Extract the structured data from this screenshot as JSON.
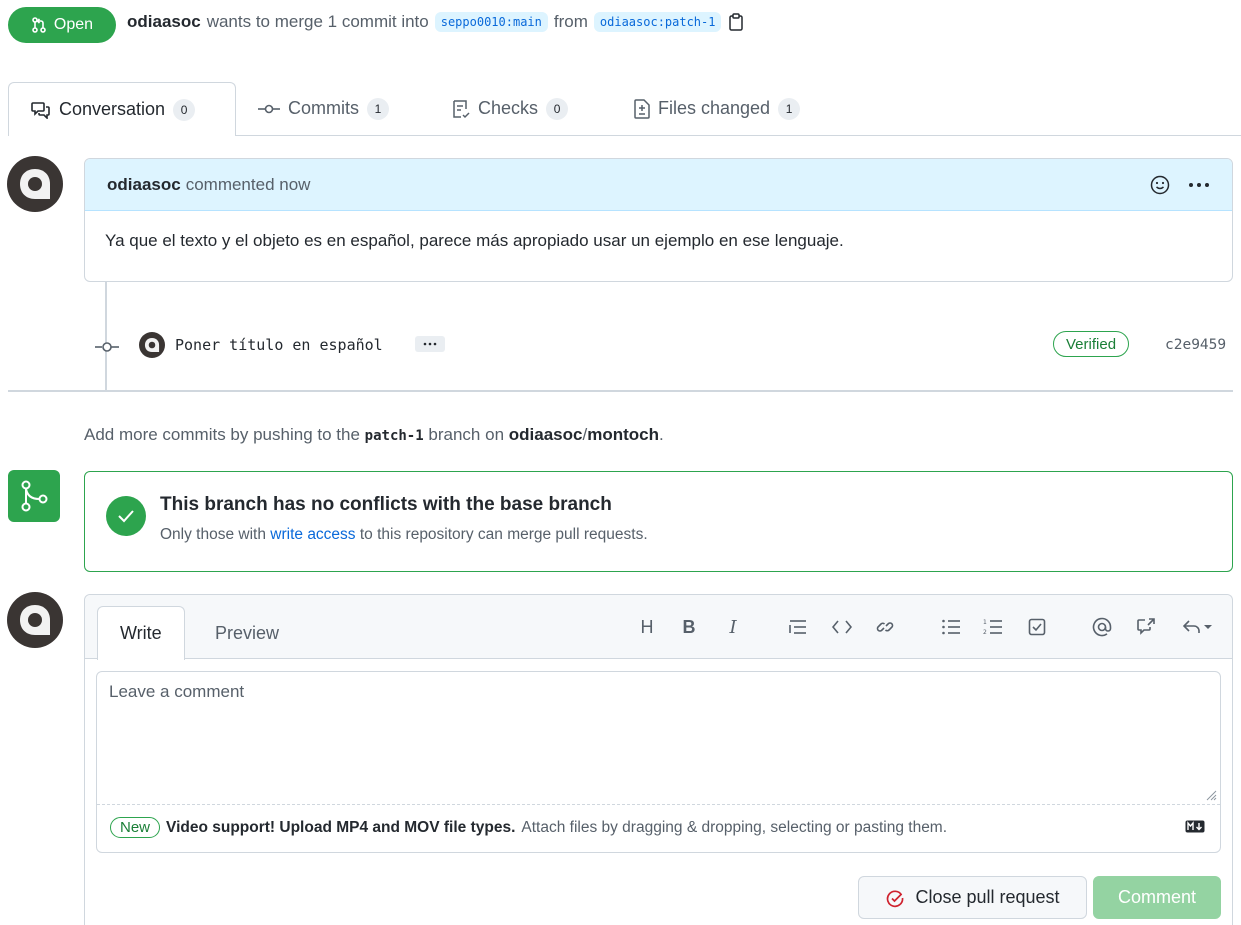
{
  "header": {
    "state": "Open",
    "author": "odiaasoc",
    "summary": "wants to merge 1 commit into",
    "base_branch": "seppo0010:main",
    "from_word": "from",
    "head_branch": "odiaasoc:patch-1"
  },
  "tabs": [
    {
      "label": "Conversation",
      "count": "0"
    },
    {
      "label": "Commits",
      "count": "1"
    },
    {
      "label": "Checks",
      "count": "0"
    },
    {
      "label": "Files changed",
      "count": "1"
    }
  ],
  "comment": {
    "author": "odiaasoc",
    "action": "commented now",
    "body": "Ya que el texto y el objeto es en español, parece más apropiado usar un ejemplo en ese lenguaje."
  },
  "commit": {
    "message": "Poner título en español",
    "verified": "Verified",
    "sha": "c2e9459"
  },
  "push_hint": {
    "prefix": "Add more commits by pushing to the",
    "branch": "patch-1",
    "middle": "branch on",
    "repo_owner": "odiaasoc",
    "repo_sep": "/",
    "repo_name": "montoch",
    "suffix": "."
  },
  "merge": {
    "title": "This branch has no conflicts with the base branch",
    "desc_prefix": "Only those with",
    "desc_link": "write access",
    "desc_suffix": "to this repository can merge pull requests."
  },
  "editor": {
    "tab_write": "Write",
    "tab_preview": "Preview",
    "placeholder": "Leave a comment",
    "new_badge": "New",
    "video_notice": "Video support! Upload MP4 and MOV file types.",
    "attach_text": "Attach files by dragging & dropping, selecting or pasting them.",
    "toolbar": {
      "heading": "H",
      "bold": "B",
      "italic": "I"
    }
  },
  "buttons": {
    "close_pr": "Close pull request",
    "comment": "Comment"
  },
  "colors": {
    "green": "#2da44e",
    "blue_link": "#0969da",
    "comment_head": "#ddf4ff",
    "close_icon_red": "#cf222e"
  }
}
